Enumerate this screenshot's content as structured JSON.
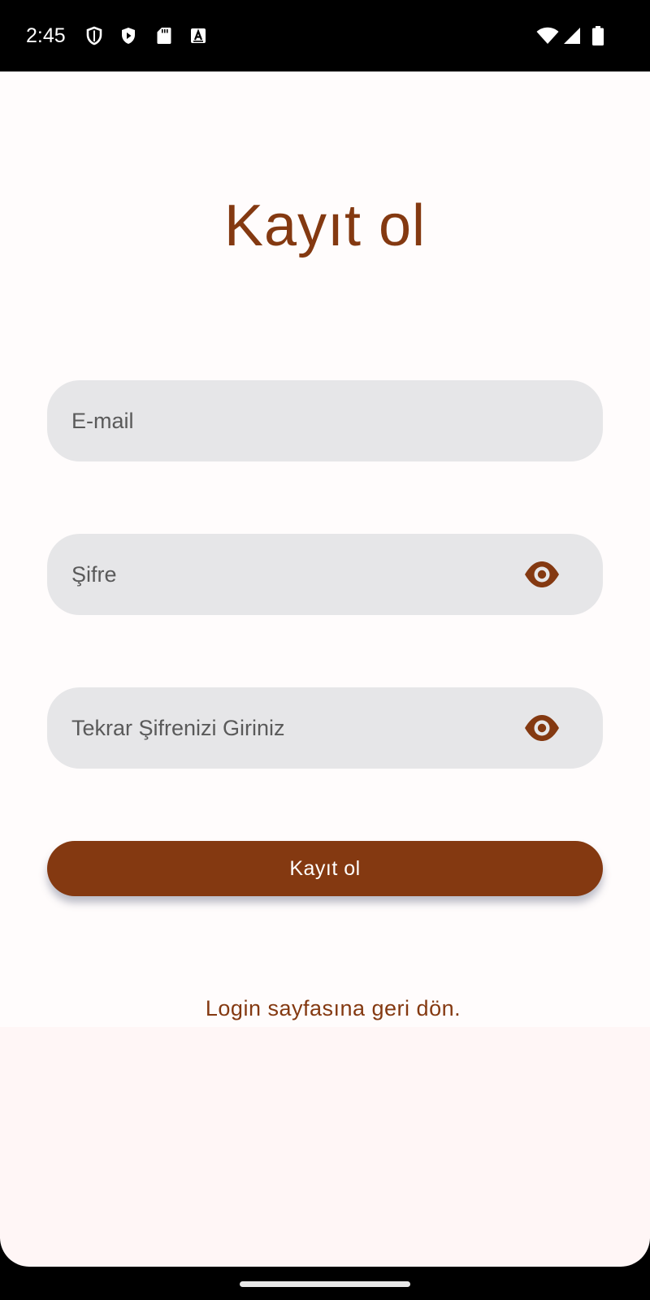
{
  "status_bar": {
    "time": "2:45",
    "icons": [
      "shield-icon",
      "play-protect-icon",
      "sd-card-icon",
      "keyboard-a-icon",
      "wifi-icon",
      "cellular-signal-icon",
      "battery-icon"
    ]
  },
  "page": {
    "title": "Kayıt ol"
  },
  "form": {
    "email_placeholder": "E-mail",
    "password_placeholder": "Şifre",
    "password_repeat_placeholder": "Tekrar Şifrenizi Giriniz",
    "submit_label": "Kayıt ol",
    "back_link_label": "Login sayfasına geri dön."
  },
  "colors": {
    "accent": "#843911",
    "field_background": "#e6e6e8",
    "page_background": "#fffcfc"
  }
}
